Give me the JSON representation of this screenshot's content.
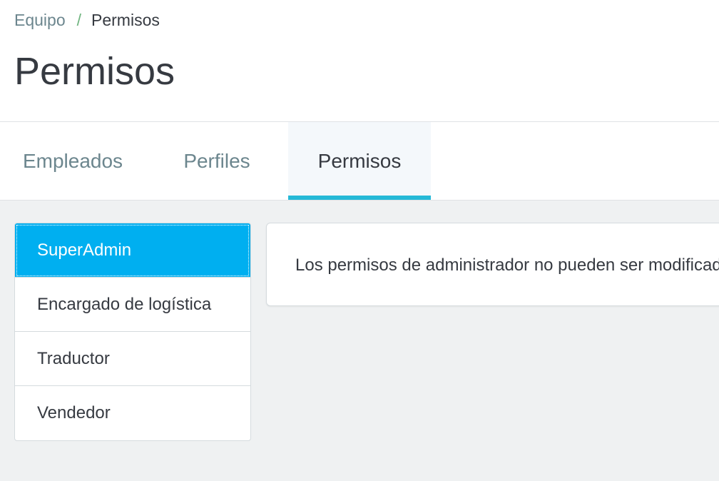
{
  "breadcrumb": {
    "parent": "Equipo",
    "separator": "/",
    "current": "Permisos"
  },
  "page_title": "Permisos",
  "tabs": [
    {
      "label": "Empleados",
      "active": false
    },
    {
      "label": "Perfiles",
      "active": false
    },
    {
      "label": "Permisos",
      "active": true
    }
  ],
  "profiles": [
    {
      "label": "SuperAdmin",
      "selected": true
    },
    {
      "label": "Encargado de logística",
      "selected": false
    },
    {
      "label": "Traductor",
      "selected": false
    },
    {
      "label": "Vendedor",
      "selected": false
    }
  ],
  "info_message": "Los permisos de administrador no pueden ser modificados.",
  "colors": {
    "accent": "#25b9d7",
    "selected_item": "#00aff0",
    "breadcrumb_separator": "#70b580",
    "text_dark": "#363a41",
    "text_muted": "#6c868e",
    "content_background": "#eff1f2"
  }
}
